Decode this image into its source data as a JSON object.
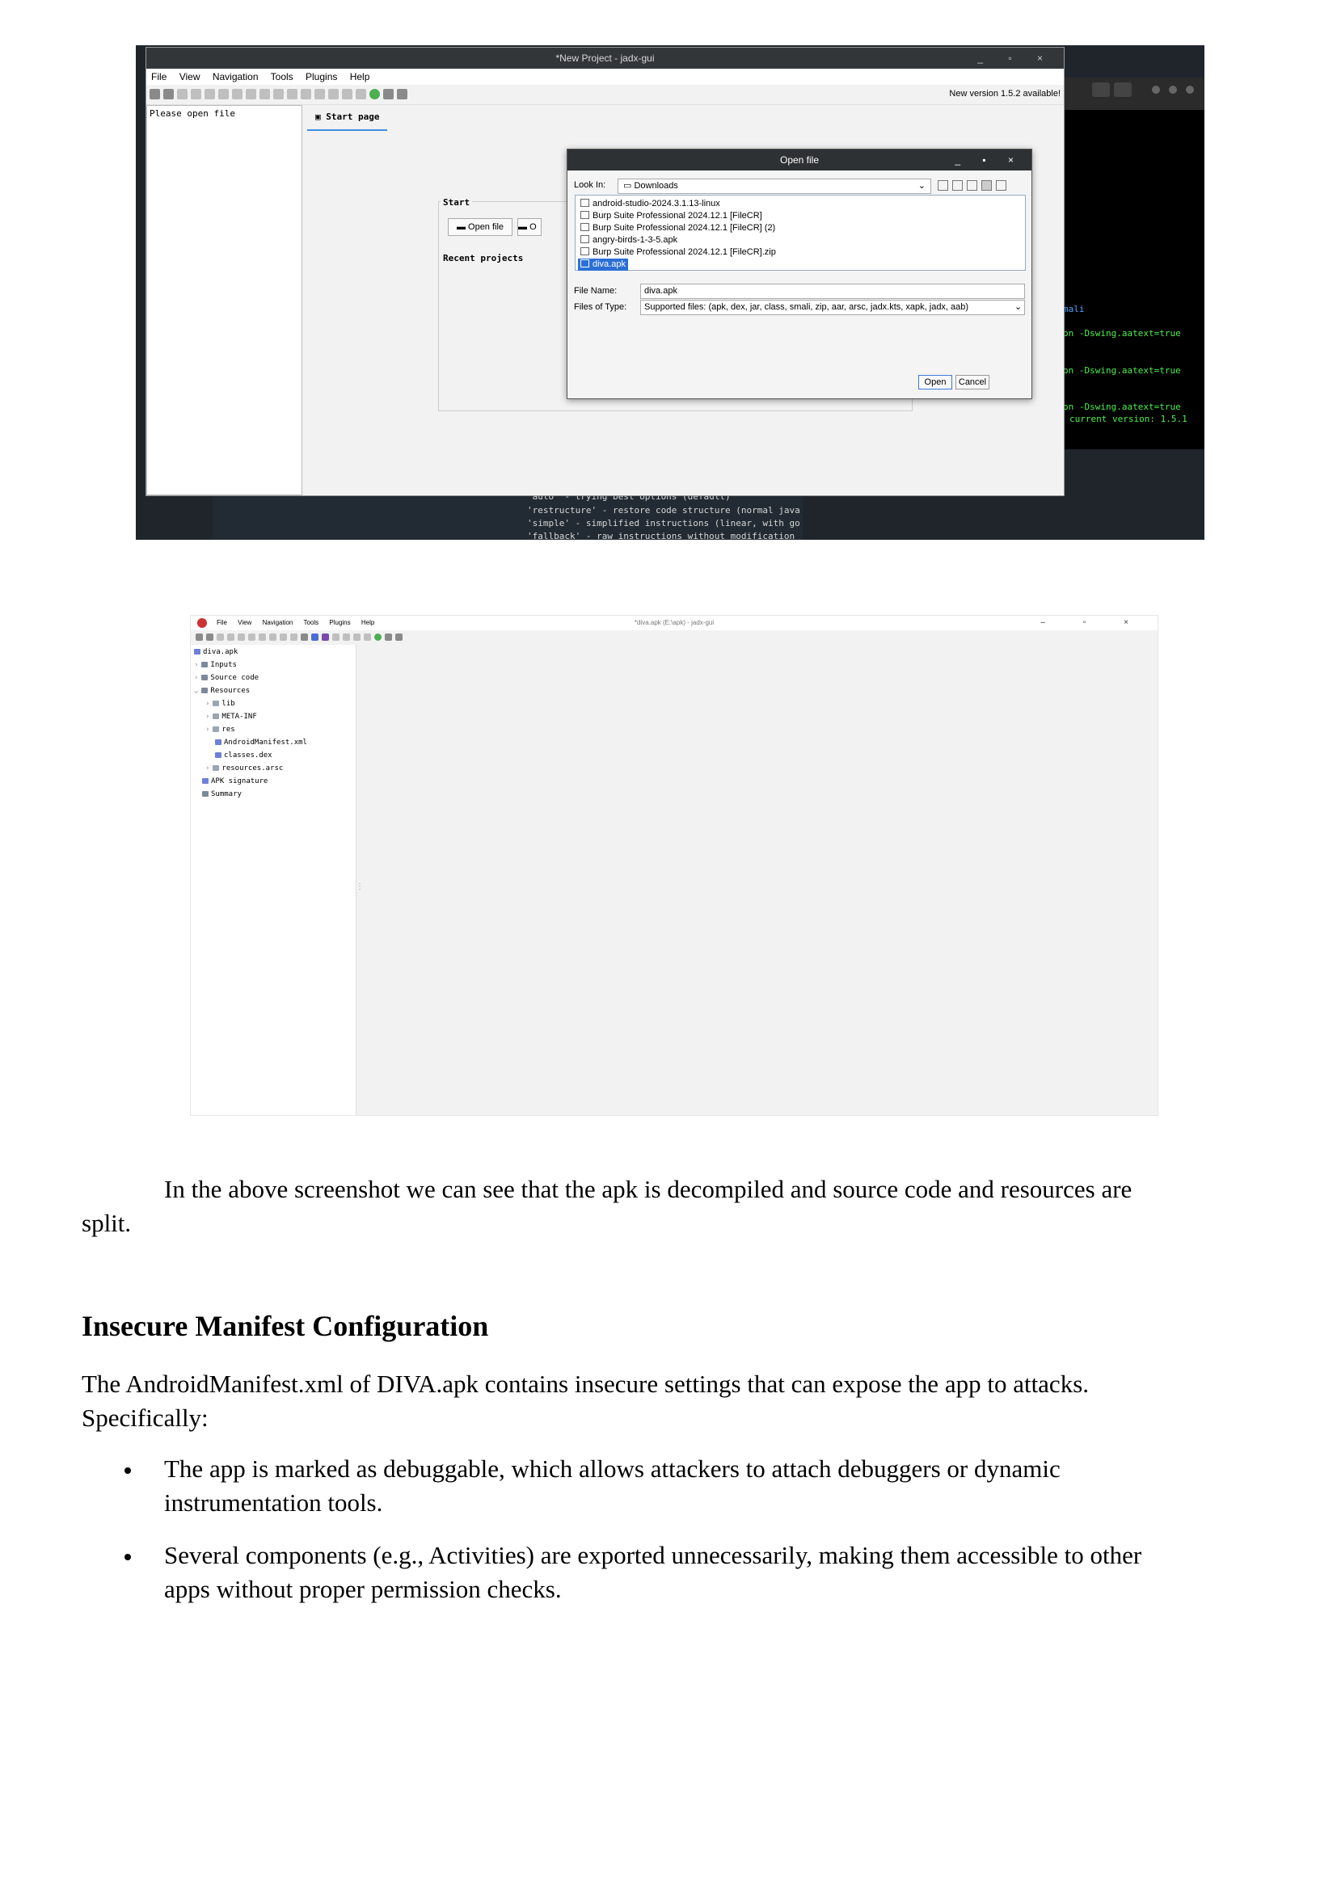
{
  "shot1": {
    "window_title": "*New Project - jadx-gui",
    "menu": [
      "File",
      "View",
      "Navigation",
      "Tools",
      "Plugins",
      "Help"
    ],
    "new_version": "New version 1.5.2 available!",
    "left_placeholder": "Please open file",
    "tab_label": "Start page",
    "start_label": "Start",
    "open_file_button": "Open file",
    "second_button_fragment": "O",
    "recent_projects_label": "Recent projects",
    "terminal_right": [
      "mali",
      "on -Dswing.aatext=true",
      "on -Dswing.aatext=true",
      "on -Dswing.aatext=true",
      "current version: 1.5.1"
    ],
    "terminal_bottom": [
      "'auto' - trying best options (default)",
      "'restructure' - restore code structure (normal java",
      "'simple' - simplified instructions (linear, with go",
      "'fallback' - raw instructions without modification"
    ],
    "dialog": {
      "title": "Open file",
      "look_in_label": "Look In:",
      "look_in_value": "Downloads",
      "files": [
        "android-studio-2024.3.1.13-linux",
        "Burp Suite Professional 2024.12.1 [FileCR]",
        "Burp Suite Professional 2024.12.1 [FileCR] (2)",
        "angry-birds-1-3-5.apk",
        "Burp Suite Professional 2024.12.1 [FileCR].zip",
        "diva.apk"
      ],
      "selected_file": "diva.apk",
      "file_name_label": "File Name:",
      "file_name_value": "diva.apk",
      "files_of_type_label": "Files of Type:",
      "files_of_type_value": "Supported files: (apk, dex, jar, class, smali, zip, aar, arsc, jadx.kts, xapk, jadx, aab)",
      "open_button": "Open",
      "cancel_button": "Cancel"
    }
  },
  "shot2": {
    "window_title": "*diva.apk (E:\\apk) - jadx-gui",
    "menu": [
      "File",
      "View",
      "Navigation",
      "Tools",
      "Plugins",
      "Help"
    ],
    "tree": {
      "root": "diva.apk",
      "inputs": "Inputs",
      "source_code": "Source code",
      "resources": "Resources",
      "lib": "lib",
      "meta_inf": "META-INF",
      "res": "res",
      "manifest": "AndroidManifest.xml",
      "classes": "classes.dex",
      "arsc": "resources.arsc",
      "apk_signature": "APK signature",
      "summary": "Summary"
    }
  },
  "text": {
    "para1_line1": "In the above screenshot we can see that the apk is decompiled and source code and resources are",
    "para1_line2": "split.",
    "heading": "Insecure Manifest Configuration",
    "para2_line1": "The AndroidManifest.xml of DIVA.apk contains insecure settings that can expose the app to attacks.",
    "para2_line2": "Specifically:",
    "bullet1_line1": "The app is marked as debuggable, which allows attackers to attach debuggers or dynamic",
    "bullet1_line2": "instrumentation tools.",
    "bullet2_line1": "Several components (e.g., Activities) are exported unnecessarily, making them accessible to other",
    "bullet2_line2": "apps without proper permission checks."
  }
}
